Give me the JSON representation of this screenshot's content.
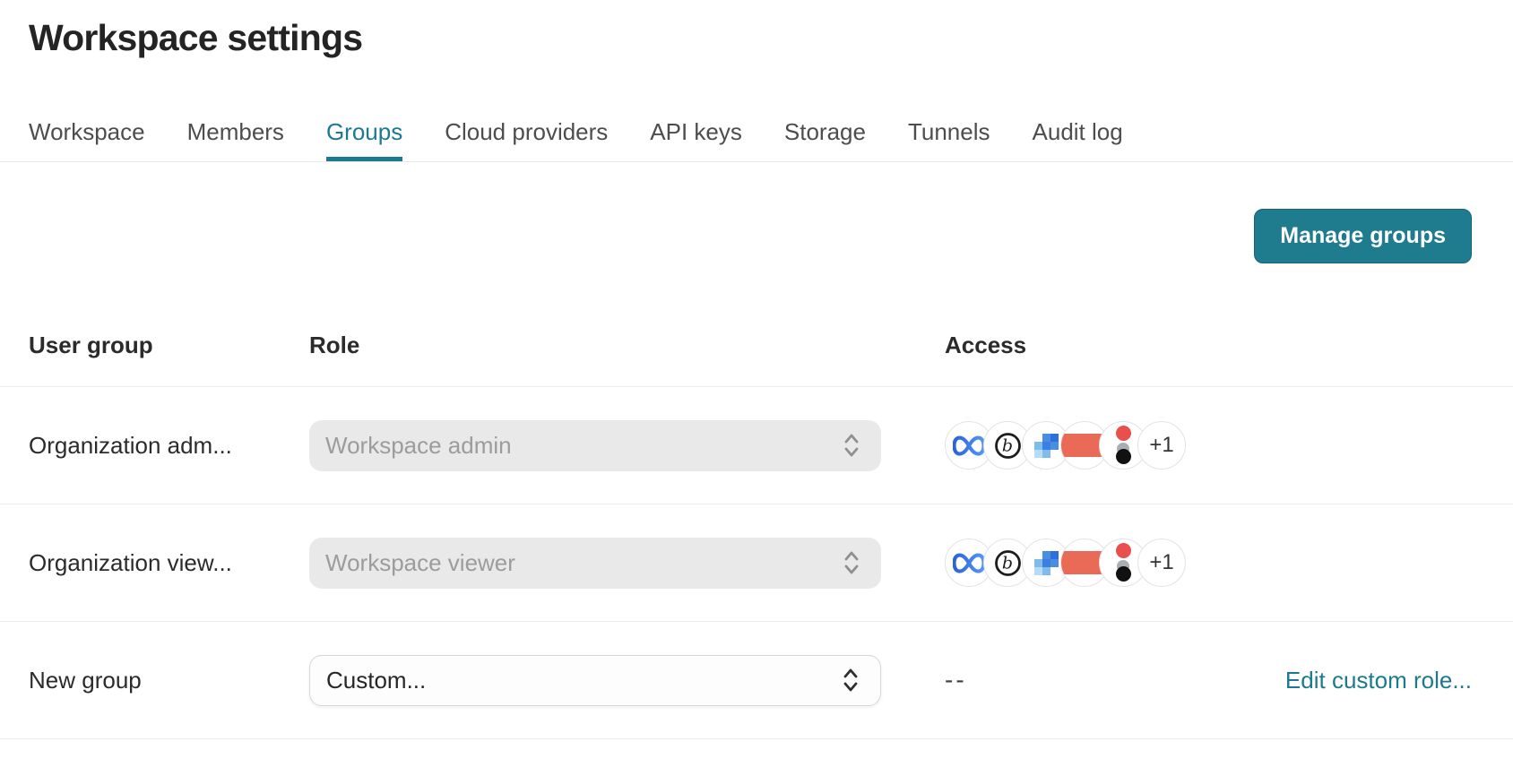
{
  "header": {
    "title": "Workspace settings"
  },
  "tabs": {
    "items": [
      {
        "label": "Workspace",
        "active": false
      },
      {
        "label": "Members",
        "active": false
      },
      {
        "label": "Groups",
        "active": true
      },
      {
        "label": "Cloud providers",
        "active": false
      },
      {
        "label": "API keys",
        "active": false
      },
      {
        "label": "Storage",
        "active": false
      },
      {
        "label": "Tunnels",
        "active": false
      },
      {
        "label": "Audit log",
        "active": false
      }
    ]
  },
  "toolbar": {
    "manage_groups_label": "Manage groups"
  },
  "table": {
    "columns": {
      "user_group": "User group",
      "role": "Role",
      "access": "Access"
    },
    "rows": [
      {
        "user_group": "Organization adm...",
        "role_value": "Workspace admin",
        "role_disabled": true,
        "access_icons": [
          "meta-infinity",
          "circled-b",
          "pixel-mosaic",
          "coral-rectangle",
          "dots-avatar"
        ],
        "access_overflow": "+1",
        "action_label": ""
      },
      {
        "user_group": "Organization view...",
        "role_value": "Workspace viewer",
        "role_disabled": true,
        "access_icons": [
          "meta-infinity",
          "circled-b",
          "pixel-mosaic",
          "coral-rectangle",
          "dots-avatar"
        ],
        "access_overflow": "+1",
        "action_label": ""
      },
      {
        "user_group": "New group",
        "role_value": "Custom...",
        "role_disabled": false,
        "access_icons": [],
        "access_placeholder": "--",
        "action_label": "Edit custom role..."
      }
    ]
  },
  "colors": {
    "accent_teal": "#1f7b8e",
    "link_teal": "#1c7a8e",
    "active_tab_teal": "#1c7a8e",
    "disabled_field_bg": "#e9e9e9",
    "disabled_field_text": "#9c9c9c",
    "coral": "#ea6a58",
    "avatar_border": "#e3e3e3",
    "row_divider": "#ededed"
  }
}
